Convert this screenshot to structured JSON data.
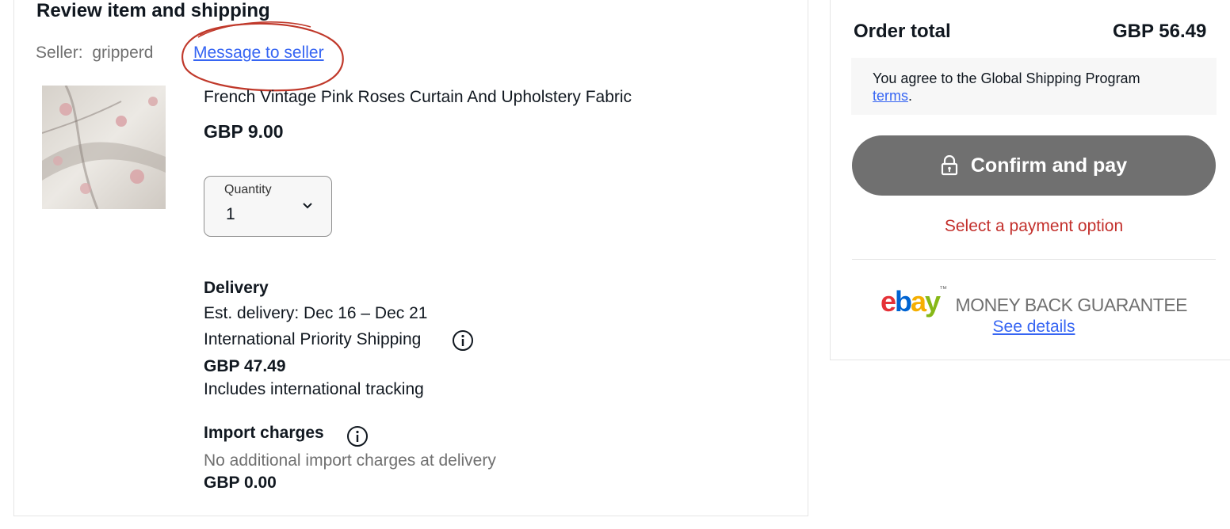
{
  "review": {
    "title": "Review item and shipping",
    "seller_label": "Seller:",
    "seller_name": "gripperd",
    "message_link": "Message to seller"
  },
  "item": {
    "title": "French Vintage Pink Roses Curtain And Upholstery Fabric",
    "price": "GBP 9.00",
    "quantity_label": "Quantity",
    "quantity_value": "1"
  },
  "delivery": {
    "title": "Delivery",
    "estimate": "Est. delivery: Dec 16 – Dec 21",
    "method": "International Priority Shipping",
    "price": "GBP 47.49",
    "tracking": "Includes international tracking"
  },
  "import": {
    "title": "Import charges",
    "note": "No additional import charges at delivery",
    "price": "GBP 0.00"
  },
  "summary": {
    "order_total_label": "Order total",
    "order_total_value": "GBP 56.49",
    "gsp_text": "You agree to the Global Shipping Program",
    "gsp_terms_link": "terms",
    "gsp_period": ".",
    "confirm_button": "Confirm and pay",
    "select_payment": "Select a payment option",
    "logo_letters": [
      "e",
      "b",
      "a",
      "y"
    ],
    "logo_tm": "™",
    "mbg_text": "MONEY BACK GUARANTEE",
    "see_details": "See details"
  },
  "icons": {
    "quantity": "chevron-down-icon",
    "shipping_info": "info-icon",
    "import_info": "info-icon",
    "confirm": "lock-icon"
  },
  "colors": {
    "link": "#3665f3",
    "error": "#c3302c",
    "button_disabled": "#707070",
    "annotation": "#c0392b",
    "ebay_e": "#e53238",
    "ebay_b": "#0064d2",
    "ebay_a": "#f5af02",
    "ebay_y": "#86b817"
  }
}
